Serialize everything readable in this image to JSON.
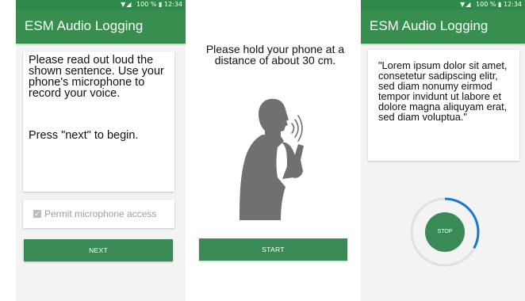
{
  "status_bar": {
    "icons": "▼◢",
    "battery": "100 %",
    "time": "12:34"
  },
  "app": {
    "title": "ESM Audio Logging"
  },
  "screen1": {
    "instruction": "Please read out loud the shown sentence. Use your phone's microphone to record your voice.",
    "begin": "Press \"next\" to begin.",
    "permit_label": "Permit microphone access",
    "permit_checked": true,
    "next_label": "NEXT"
  },
  "screen2": {
    "instruction": "Please hold your phone at a distance of about 30 cm.",
    "start_label": "START"
  },
  "screen3": {
    "quote": "\"Lorem ipsum dolor sit amet, consetetur sadipscing elitr, sed diam nonumy eirmod tempor invidunt ut labore et dolore magna aliquyam erat, sed diam voluptua.\"",
    "stop_label": "STOP",
    "recording_progress": 0.33
  },
  "colors": {
    "primary": "#388e4f",
    "status_bar": "#2d8a4a",
    "button": "#3a8a55",
    "progress_ring": "#1976d2",
    "ring_track": "#e0e0e0",
    "silhouette": "#707070"
  },
  "icons": {
    "person": "person-speaking-into-phone-icon",
    "checkbox": "checkmark-icon",
    "wifi": "wifi-icon",
    "signal": "signal-icon",
    "battery": "battery-icon"
  }
}
